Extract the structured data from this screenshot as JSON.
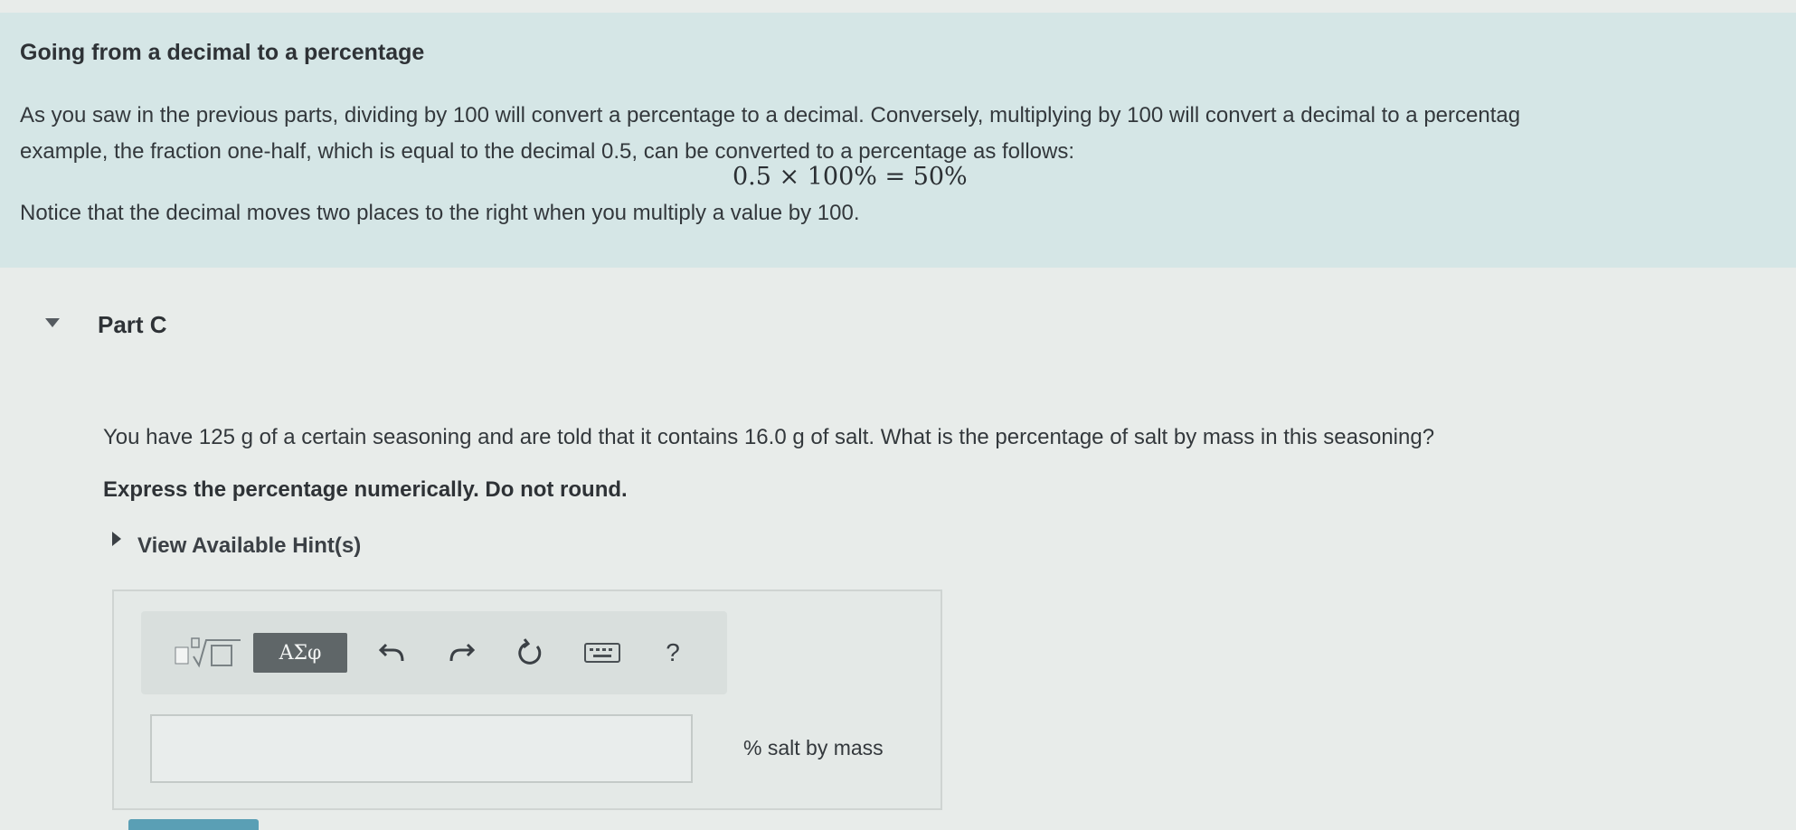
{
  "intro": {
    "title": "Going from a decimal to a percentage",
    "paragraph_line1": "As you saw in the previous parts, dividing by 100 will convert a percentage to a decimal. Conversely, multiplying by 100 will convert a decimal to a percentag",
    "paragraph_line2": "example, the fraction one-half, which is equal to the decimal 0.5, can be converted to a percentage as follows:",
    "equation": "0.5 × 100% = 50%",
    "note": "Notice that the decimal moves two places to the right when you multiply a value by 100."
  },
  "part": {
    "title": "Part C",
    "question": "You have 125 g of a certain seasoning and are told that it contains 16.0 g of salt. What is the percentage of salt by mass in this seasoning?",
    "instruction": "Express the percentage numerically. Do not round.",
    "hint_link": "View Available Hint(s)"
  },
  "toolbar": {
    "symbols_label": "ΑΣφ",
    "help_label": "?",
    "icons": [
      "templates-icon",
      "undo-icon",
      "redo-icon",
      "reset-icon",
      "keyboard-icon",
      "help-icon"
    ]
  },
  "answer": {
    "value": "",
    "units": "% salt by mass"
  },
  "colors": {
    "intro_bg": "#d5e6e6",
    "page_bg": "#e8ecea",
    "symbols_button": "#5f6668",
    "submit_button": "#5a9fb5"
  }
}
